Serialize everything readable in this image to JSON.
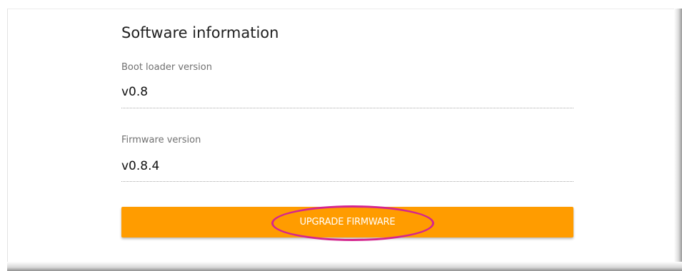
{
  "software_info": {
    "title": "Software information",
    "fields": [
      {
        "label": "Boot loader version",
        "value": "v0.8"
      },
      {
        "label": "Firmware version",
        "value": "v0.8.4"
      }
    ],
    "upgrade_button_label": "UPGRADE FIRMWARE"
  },
  "colors": {
    "accent": "#ff9c00",
    "annotation": "#d4258f"
  }
}
